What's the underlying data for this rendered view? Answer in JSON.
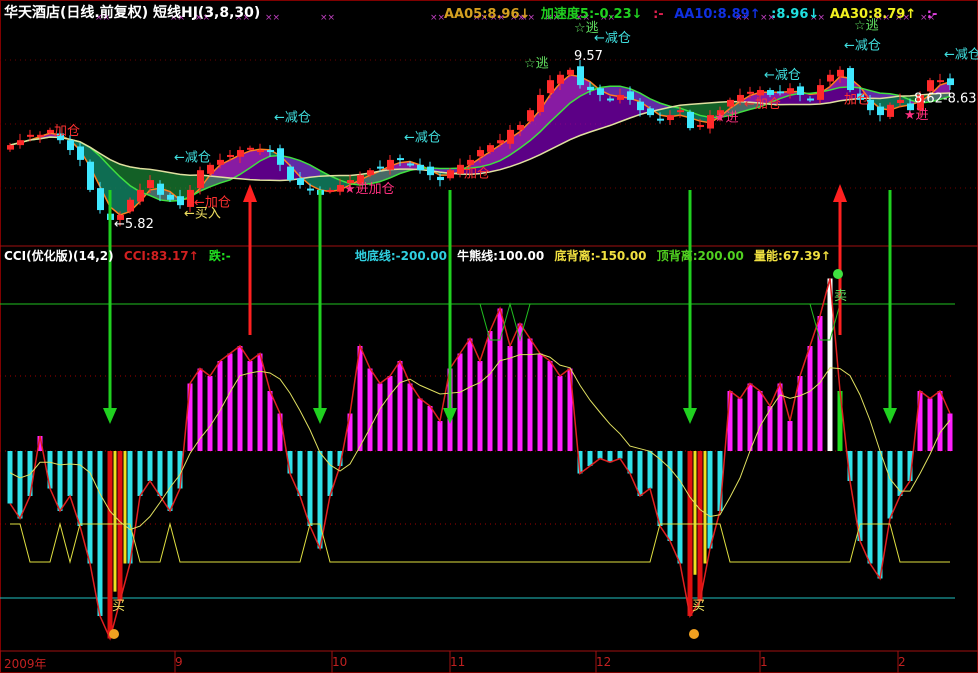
{
  "header": {
    "title": "华天酒店(日线.前复权) 短线HJ(3,8,30)",
    "items": [
      {
        "text": "AA05:8.96↓",
        "color": "#d4a020"
      },
      {
        "text": "加速度5:-0.23↓",
        "color": "#20d020"
      },
      {
        "text": ":-",
        "color": "#e02050"
      },
      {
        "text": "AA10:8.89↑",
        "color": "#1030e0"
      },
      {
        "text": ":8.96↓",
        "color": "#20e0e0"
      },
      {
        "text": "AA30:8.79↑",
        "color": "#f0f020"
      },
      {
        "text": ":-",
        "color": "#e040e0"
      }
    ]
  },
  "cci_header": {
    "title": "CCI(优化版)(14,2)",
    "items": [
      {
        "text": "CCI:83.17↑",
        "color": "#d02020"
      },
      {
        "text": "跌:-",
        "color": "#20e020"
      },
      {
        "text": "地底线:-200.00",
        "color": "#30d0e0"
      },
      {
        "text": "牛熊线:100.00",
        "color": "#ffffff"
      },
      {
        "text": "底背离:-150.00",
        "color": "#f0e040"
      },
      {
        "text": "顶背离:200.00",
        "color": "#50d020"
      },
      {
        "text": "量能:67.39↑",
        "color": "#f0e040"
      }
    ]
  },
  "colors": {
    "up": "#ff2a2a",
    "down": "#40e8ff",
    "cci_pos": "#ff20ff",
    "cci_neg": "#30e0e8",
    "buy_arrow": "#20d020",
    "sell_arrow": "#ff2020"
  },
  "chart_data": [
    {
      "type": "candlestick",
      "title": "华天酒店 日线",
      "close": [
        7.67,
        7.78,
        7.9,
        7.9,
        8.01,
        7.78,
        7.56,
        7.34,
        6.67,
        6.22,
        6.0,
        6.11,
        6.45,
        6.67,
        6.89,
        6.56,
        6.45,
        6.33,
        6.67,
        7.11,
        7.23,
        7.34,
        7.45,
        7.56,
        7.61,
        7.56,
        7.52,
        7.23,
        6.89,
        6.78,
        6.67,
        6.56,
        6.67,
        6.78,
        6.89,
        7.0,
        7.11,
        7.16,
        7.34,
        7.34,
        7.23,
        7.11,
        7.0,
        6.89,
        7.11,
        7.23,
        7.34,
        7.56,
        7.67,
        7.78,
        8.01,
        8.12,
        8.45,
        8.79,
        9.12,
        9.24,
        9.35,
        9.01,
        8.9,
        8.79,
        8.68,
        8.79,
        8.68,
        8.45,
        8.34,
        8.23,
        8.34,
        8.45,
        8.05,
        8.12,
        8.34,
        8.45,
        8.68,
        8.79,
        8.86,
        8.9,
        8.79,
        8.86,
        8.94,
        8.79,
        8.68,
        9.01,
        9.24,
        9.35,
        8.9,
        8.68,
        8.45,
        8.34,
        8.57,
        8.68,
        8.45,
        8.79,
        9.12,
        9.12,
        9.01
      ],
      "annotations": [
        {
          "bar": 4,
          "price": 7.9,
          "text": "加仓",
          "color": "#ff3030"
        },
        {
          "bar": 16,
          "price": 7.3,
          "text": "←减仓",
          "color": "#40e0e0"
        },
        {
          "bar": 10,
          "price": 5.82,
          "text": "←5.82",
          "color": "#ffffff"
        },
        {
          "bar": 18,
          "price": 6.3,
          "text": "←加仓",
          "color": "#ff3030"
        },
        {
          "bar": 17,
          "price": 6.05,
          "text": "←买入",
          "color": "#f0e060"
        },
        {
          "bar": 26,
          "price": 8.2,
          "text": "←减仓",
          "color": "#40e0e0"
        },
        {
          "bar": 33,
          "price": 6.6,
          "text": "★进加仓",
          "color": "#ff3080"
        },
        {
          "bar": 39,
          "price": 7.75,
          "text": "←减仓",
          "color": "#40e0e0"
        },
        {
          "bar": 45,
          "price": 6.95,
          "text": "加仓",
          "color": "#ff3030"
        },
        {
          "bar": 51,
          "price": 9.4,
          "text": "☆逃",
          "color": "#60e060"
        },
        {
          "bar": 56,
          "price": 9.57,
          "text": "9.57",
          "color": "#ffffff"
        },
        {
          "bar": 56,
          "price": 10.2,
          "text": "☆逃",
          "color": "#60e060"
        },
        {
          "bar": 58,
          "price": 9.97,
          "text": "←减仓",
          "color": "#40e0e0"
        },
        {
          "bar": 70,
          "price": 8.2,
          "text": "★进",
          "color": "#ff3080"
        },
        {
          "bar": 73,
          "price": 8.5,
          "text": "←加仓",
          "color": "#ff3030"
        },
        {
          "bar": 75,
          "price": 9.15,
          "text": "←减仓",
          "color": "#40e0e0"
        },
        {
          "bar": 83,
          "price": 8.6,
          "text": "加仓",
          "color": "#ff3030"
        },
        {
          "bar": 83,
          "price": 9.8,
          "text": "←减仓",
          "color": "#40e0e0"
        },
        {
          "bar": 84,
          "price": 10.25,
          "text": "☆逃",
          "color": "#60e060"
        },
        {
          "bar": 89,
          "price": 8.25,
          "text": "★进",
          "color": "#ff3080"
        },
        {
          "bar": 90,
          "price": 8.62,
          "text": "8.62-8.63",
          "color": "#ffffff"
        },
        {
          "bar": 93,
          "price": 9.6,
          "text": "←减仓",
          "color": "#40e0e0"
        }
      ]
    },
    {
      "type": "bar",
      "title": "CCI(优化版)(14,2)",
      "values": [
        -70,
        -90,
        -60,
        20,
        -50,
        -80,
        -60,
        -100,
        -150,
        -220,
        -250,
        -200,
        -150,
        -60,
        -40,
        -60,
        -80,
        -50,
        90,
        110,
        100,
        120,
        130,
        140,
        120,
        130,
        80,
        50,
        -30,
        -60,
        -100,
        -130,
        -60,
        -20,
        50,
        140,
        110,
        90,
        100,
        120,
        90,
        70,
        60,
        40,
        110,
        130,
        150,
        120,
        160,
        190,
        140,
        170,
        150,
        130,
        120,
        100,
        110,
        -30,
        -20,
        -10,
        -15,
        -10,
        -30,
        -60,
        -50,
        -100,
        -120,
        -150,
        -220,
        -200,
        -130,
        -80,
        80,
        70,
        90,
        80,
        60,
        90,
        40,
        100,
        140,
        180,
        230,
        80,
        -40,
        -120,
        -150,
        -170,
        -90,
        -60,
        -40,
        80,
        70,
        80,
        50
      ],
      "reference_lines": [
        200,
        100,
        0,
        -100,
        -200
      ],
      "ylim": [
        -280,
        260
      ],
      "buy_signals": [
        {
          "bar": 10,
          "text": "买"
        },
        {
          "bar": 68,
          "text": "买"
        }
      ],
      "sell_signals": [
        {
          "bar": 82,
          "text": "卖"
        }
      ],
      "down_arrow_bars": [
        10,
        31,
        44,
        68,
        88
      ],
      "up_arrow_bars": [
        24,
        83
      ]
    }
  ],
  "xaxis": {
    "labels": [
      "2009年",
      "9",
      "10",
      "11",
      "12",
      "1",
      "2"
    ]
  }
}
